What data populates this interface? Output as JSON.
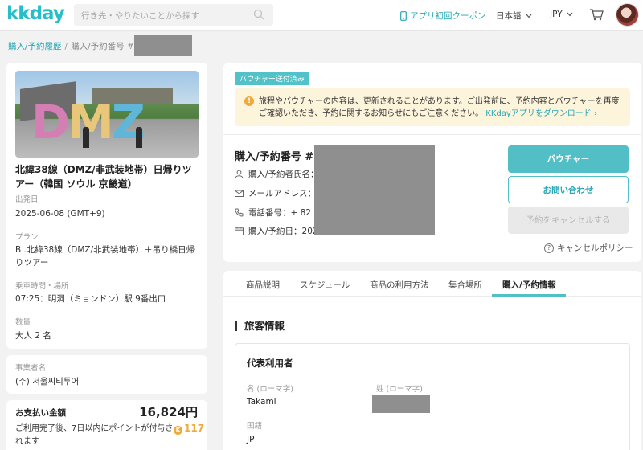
{
  "header": {
    "logo": "kkday",
    "search_placeholder": "行き先・やりたいことから探す",
    "coupon_label": "アプリ初回クーポン",
    "language": "日本語",
    "currency": "JPY",
    "accent_color": "#26bec9"
  },
  "breadcrumb": {
    "history_link": "購入/予約履歴",
    "separator": "/",
    "current": "購入/予約番号 #2"
  },
  "product": {
    "photo_text": {
      "d": "D",
      "m": "M",
      "z": "Z"
    },
    "title": "北緯38線（DMZ/非武装地帯）日帰りツアー（韓国 ソウル 京畿道）",
    "departure_label": "出発日",
    "departure_value": "2025-06-08 (GMT+9)",
    "plan_label": "プラン",
    "plan_value": "B .北緯38線（DMZ/非武装地帯）＋吊り橋日帰りツアー",
    "pickup_label": "乗車時間・場所",
    "pickup_value": "07:25：明洞（ミョンドン）駅 9番出口",
    "qty_label": "数量",
    "qty_value": "大人 2 名"
  },
  "operator": {
    "label": "事業者名",
    "value": "(주) 서울씨티투어"
  },
  "payment": {
    "label": "お支払い金額",
    "amount": "16,824円",
    "note": "ご利用完了後、7日以内にポイントが付与されます",
    "coin_symbol": "K",
    "points": "117"
  },
  "order": {
    "badge": "バウチャー送付済み",
    "notice": "旅程やバウチャーの内容は、更新されることがあります。ご出発前に、予約内容とバウチャーを再度ご確認いただき、予約に関するお知らせにもご注意ください。",
    "notice_link": "KKdayアプリをダウンロード ›",
    "order_no": "購入/予約番号 #2",
    "buyer_label": "購入/予約者氏名：",
    "email_label": "メールアドレス：t",
    "phone_label": "電話番号：+ 82 010",
    "date_label": "購入/予約日：2025",
    "btn_voucher": "バウチャー",
    "btn_contact": "お問い合わせ",
    "btn_cancel": "予約をキャンセルする",
    "cancel_policy": "キャンセルポリシー"
  },
  "tabs": [
    "商品説明",
    "スケジュール",
    "商品の利用方法",
    "集合場所",
    "購入/予約情報"
  ],
  "traveler": {
    "section_title": "旅客情報",
    "rep_title": "代表利用者",
    "first_name_label": "名 (ローマ字)",
    "first_name_value": "Takami",
    "last_name_label": "姓 (ローマ字)",
    "nationality_label": "国籍",
    "nationality_value": "JP"
  }
}
